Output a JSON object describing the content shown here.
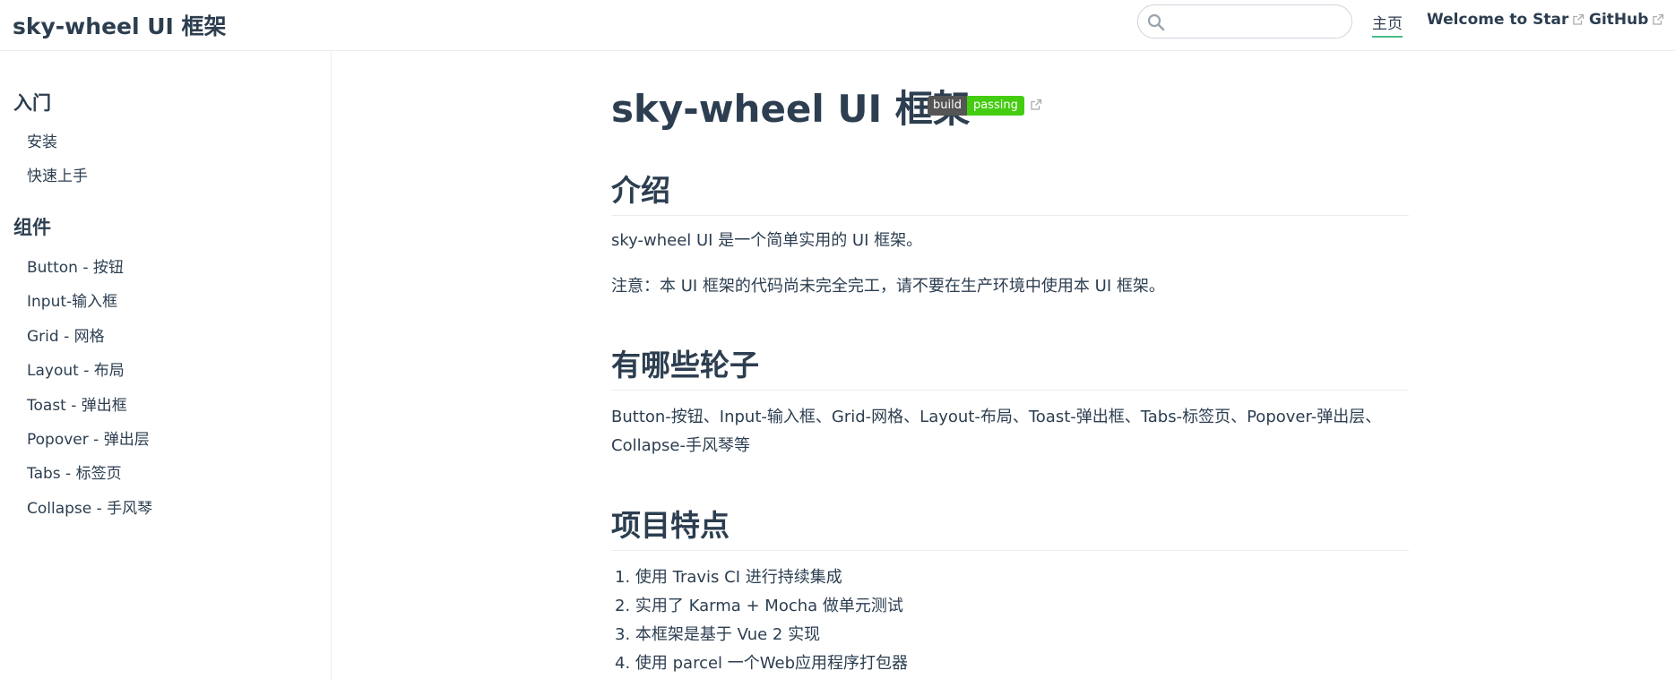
{
  "navbar": {
    "site_name": "sky-wheel UI 框架",
    "search_placeholder": "",
    "links": [
      {
        "label": "主页"
      },
      {
        "label": "Welcome to Star"
      },
      {
        "label": "GitHub"
      }
    ]
  },
  "sidebar": {
    "groups": [
      {
        "title": "入门",
        "items": [
          "安装",
          "快速上手"
        ]
      },
      {
        "title": "组件",
        "items": [
          "Button - 按钮",
          "Input-输入框",
          "Grid - 网格",
          "Layout - 布局",
          "Toast - 弹出框",
          "Popover - 弹出层",
          "Tabs - 标签页",
          "Collapse - 手风琴"
        ]
      }
    ]
  },
  "content": {
    "title": "sky-wheel UI 框架",
    "badge": {
      "left": "build",
      "right": "passing"
    },
    "sections": [
      {
        "heading": "介绍",
        "paragraphs": [
          "sky-wheel UI 是一个简单实用的 UI 框架。",
          "注意：本 UI 框架的代码尚未完全完工，请不要在生产环境中使用本 UI 框架。"
        ]
      },
      {
        "heading": "有哪些轮子",
        "paragraphs": [
          "Button-按钮、Input-输入框、Grid-网格、Layout-布局、Toast-弹出框、Tabs-标签页、Popover-弹出层、Collapse-手风琴等"
        ]
      },
      {
        "heading": "项目特点",
        "list": [
          "1. 使用 Travis CI 进行持续集成",
          "2. 实用了 Karma + Mocha 做单元测试",
          "3. 本框架是基于 Vue 2 实现",
          "4. 使用 parcel 一个Web应用程序打包器"
        ]
      }
    ]
  },
  "colors": {
    "accent": "#46bd87",
    "text": "#2c3e50",
    "badge_left": "#555555",
    "badge_right": "#44cc11"
  }
}
